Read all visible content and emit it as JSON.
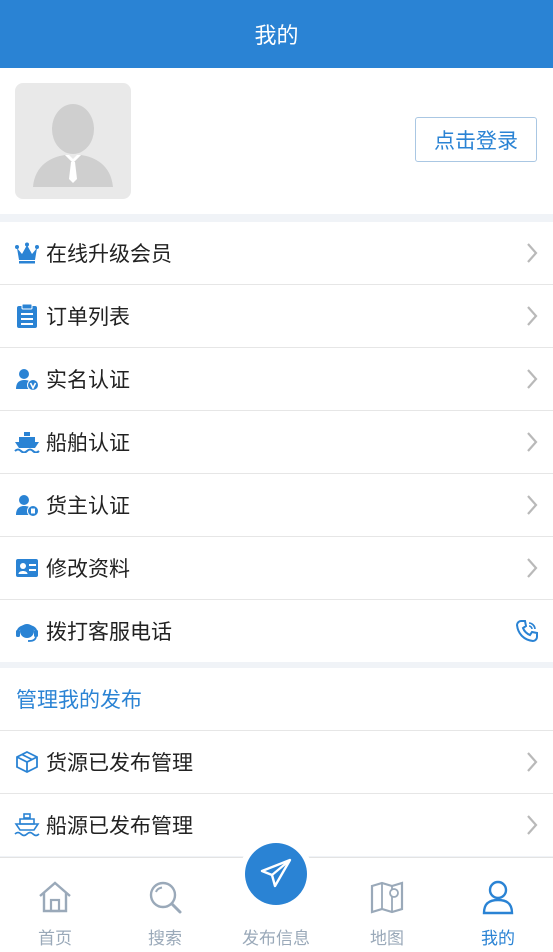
{
  "header": {
    "title": "我的"
  },
  "profile": {
    "login_label": "点击登录"
  },
  "menu1": [
    {
      "icon": "crown-icon",
      "label": "在线升级会员"
    },
    {
      "icon": "clipboard-icon",
      "label": "订单列表"
    }
  ],
  "menu2": [
    {
      "icon": "user-verified-icon",
      "label": "实名认证"
    },
    {
      "icon": "ship-icon",
      "label": "船舶认证"
    },
    {
      "icon": "user-badge-icon",
      "label": "货主认证"
    },
    {
      "icon": "id-card-icon",
      "label": "修改资料"
    },
    {
      "icon": "headset-icon",
      "label": "拨打客服电话"
    }
  ],
  "publish_section": {
    "title": "管理我的发布",
    "items": [
      {
        "icon": "package-icon",
        "label": "货源已发布管理"
      },
      {
        "icon": "boat-outline-icon",
        "label": "船源已发布管理"
      }
    ]
  },
  "tabbar": {
    "home": "首页",
    "search": "搜索",
    "publish": "发布信息",
    "map": "地图",
    "mine": "我的"
  },
  "colors": {
    "primary": "#2a83d4",
    "inactive": "#9aa9b9"
  }
}
